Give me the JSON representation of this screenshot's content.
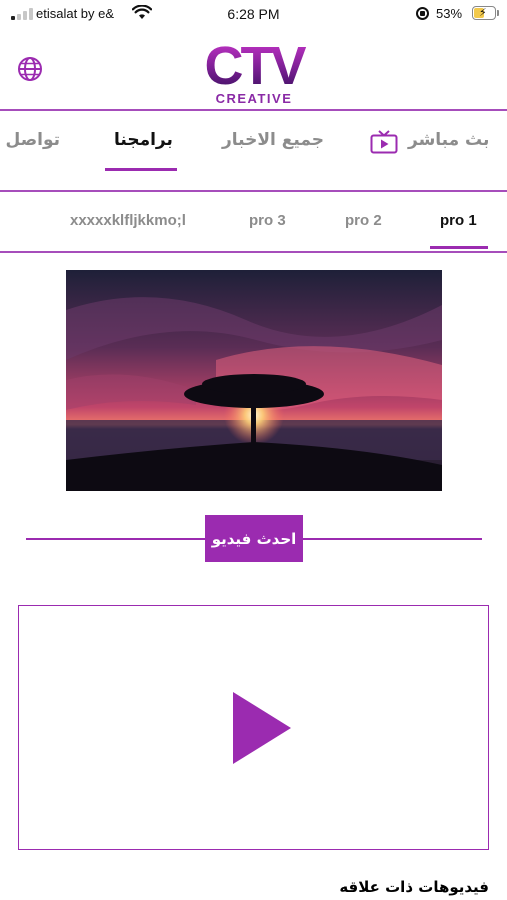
{
  "status_bar": {
    "carrier": "etisalat by e&",
    "time": "6:28 PM",
    "battery_percent": "53%",
    "battery_level": 0.53
  },
  "header": {
    "logo_main": "CTV",
    "logo_sub": "CREATIVE",
    "language_icon": "globe-icon"
  },
  "main_tabs": [
    {
      "label": "بث مباشر",
      "icon": "tv-icon",
      "active": false
    },
    {
      "label": "جميع الاخبار",
      "active": false
    },
    {
      "label": "برامجنا",
      "active": true
    },
    {
      "label": "تواصل معنا",
      "active": false
    }
  ],
  "sub_tabs": [
    {
      "label": "pro 1",
      "active": true
    },
    {
      "label": "pro 2",
      "active": false
    },
    {
      "label": "pro 3",
      "active": false
    },
    {
      "label": "xxxxxklfljkkmo;l",
      "active": false
    }
  ],
  "latest_video": {
    "heading": "احدث فيديو",
    "play_icon": "play-icon"
  },
  "related": {
    "heading": "فيديوهات ذات علاقه"
  },
  "colors": {
    "accent": "#9b2bb0",
    "inactive_text": "#8c8c8c",
    "active_text": "#111111"
  }
}
